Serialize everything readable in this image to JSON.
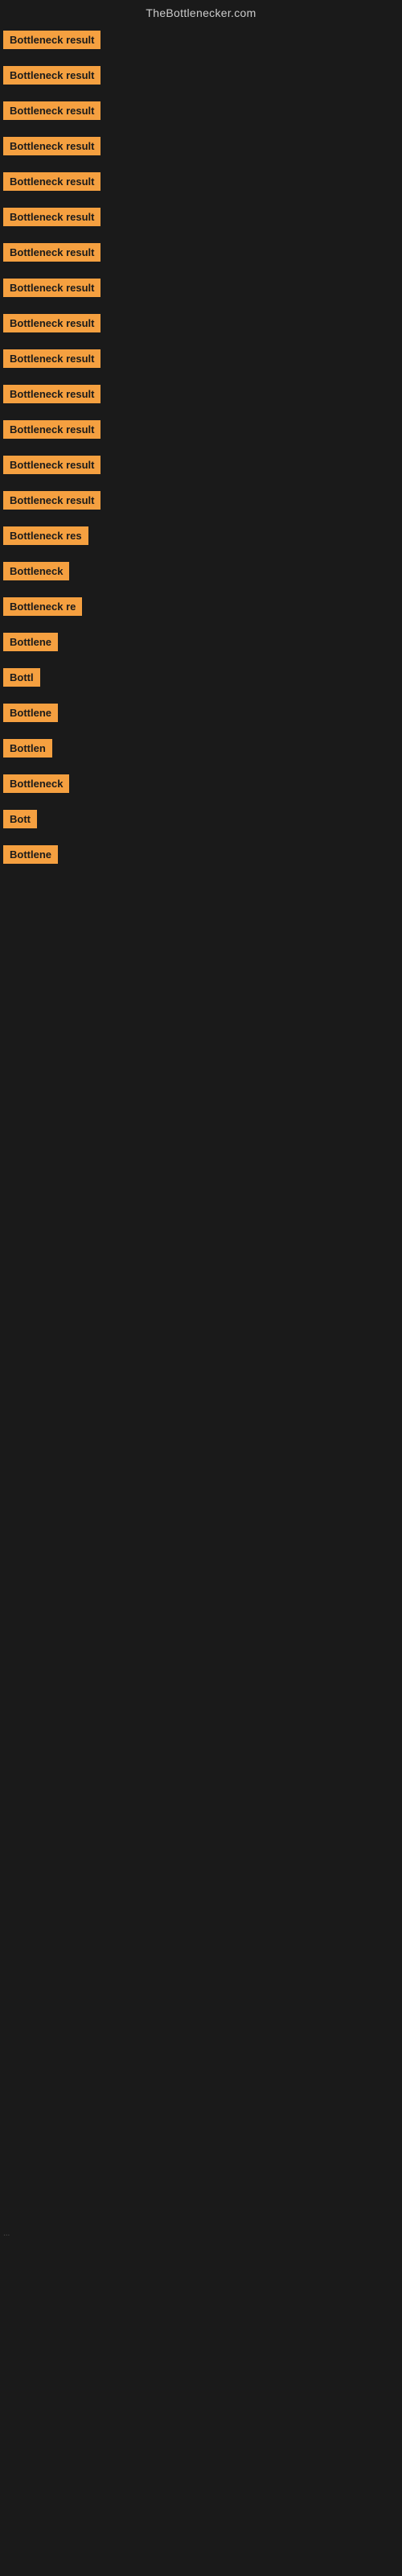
{
  "header": {
    "title": "TheBottlenecker.com"
  },
  "rows": [
    {
      "id": 1,
      "label": "Bottleneck result"
    },
    {
      "id": 2,
      "label": "Bottleneck result"
    },
    {
      "id": 3,
      "label": "Bottleneck result"
    },
    {
      "id": 4,
      "label": "Bottleneck result"
    },
    {
      "id": 5,
      "label": "Bottleneck result"
    },
    {
      "id": 6,
      "label": "Bottleneck result"
    },
    {
      "id": 7,
      "label": "Bottleneck result"
    },
    {
      "id": 8,
      "label": "Bottleneck result"
    },
    {
      "id": 9,
      "label": "Bottleneck result"
    },
    {
      "id": 10,
      "label": "Bottleneck result"
    },
    {
      "id": 11,
      "label": "Bottleneck result"
    },
    {
      "id": 12,
      "label": "Bottleneck result"
    },
    {
      "id": 13,
      "label": "Bottleneck result"
    },
    {
      "id": 14,
      "label": "Bottleneck result"
    },
    {
      "id": 15,
      "label": "Bottleneck res"
    },
    {
      "id": 16,
      "label": "Bottleneck"
    },
    {
      "id": 17,
      "label": "Bottleneck re"
    },
    {
      "id": 18,
      "label": "Bottlene"
    },
    {
      "id": 19,
      "label": "Bottl"
    },
    {
      "id": 20,
      "label": "Bottlene"
    },
    {
      "id": 21,
      "label": "Bottlen"
    },
    {
      "id": 22,
      "label": "Bottleneck"
    },
    {
      "id": 23,
      "label": "Bott"
    },
    {
      "id": 24,
      "label": "Bottlene"
    }
  ],
  "ellipsis": "...",
  "colors": {
    "background": "#1a1a1a",
    "badge": "#f5a040",
    "header_text": "#cccccc"
  }
}
